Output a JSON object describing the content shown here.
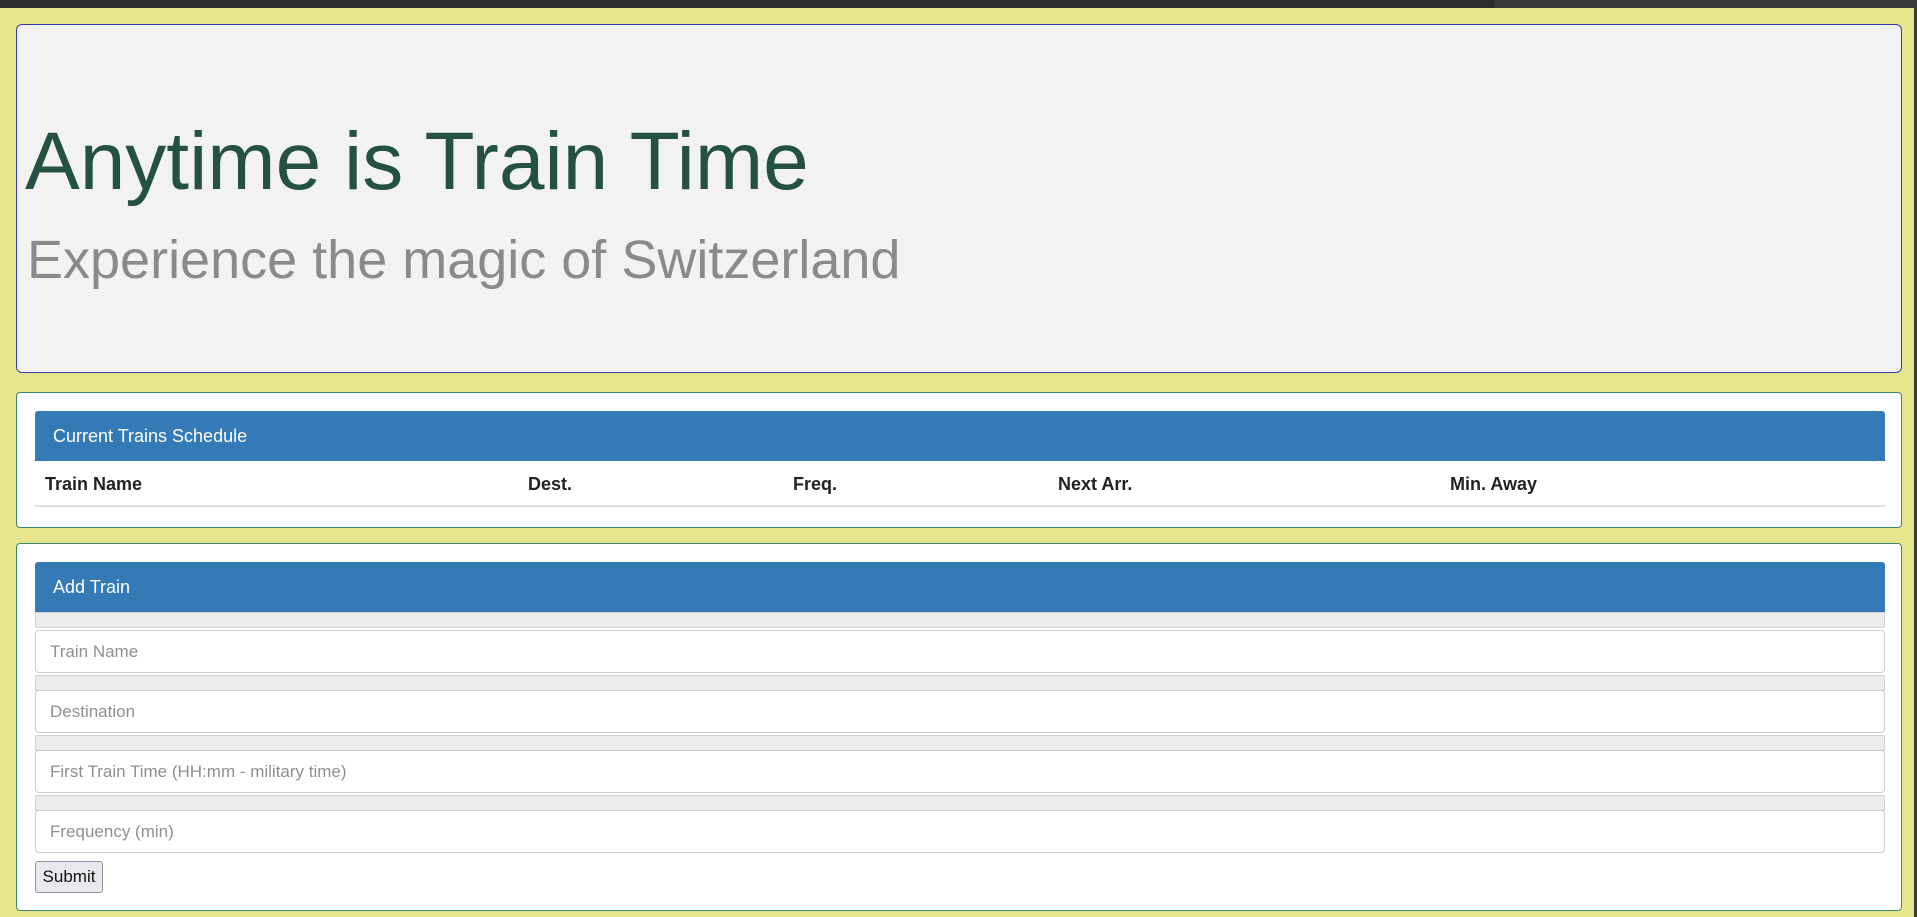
{
  "jumbotron": {
    "title": "Anytime is Train Time",
    "subtitle": "Experience the magic of Switzerland"
  },
  "schedule": {
    "heading": "Current Trains Schedule",
    "columns": [
      "Train Name",
      "Dest.",
      "Freq.",
      "Next Arr.",
      "Min. Away"
    ],
    "rows": []
  },
  "add_train": {
    "heading": "Add Train",
    "fields": {
      "train_name": {
        "placeholder": "Train Name",
        "value": ""
      },
      "destination": {
        "placeholder": "Destination",
        "value": ""
      },
      "first_time": {
        "placeholder": "First Train Time (HH:mm - military time)",
        "value": ""
      },
      "frequency": {
        "placeholder": "Frequency (min)",
        "value": ""
      }
    },
    "submit_label": "Submit"
  },
  "colors": {
    "page_background": "#e6e58d",
    "jumbotron_background": "#f2f2f2",
    "title_color": "#245142",
    "subtitle_color": "#8a8a8a",
    "panel_heading": "#337ab7"
  }
}
